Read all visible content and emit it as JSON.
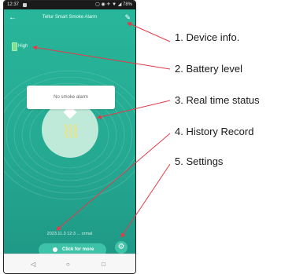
{
  "status_bar": {
    "time": "12:37",
    "indicators": "▢ ◉ ✈ ▼ ◢ 78%"
  },
  "header": {
    "back_icon": "←",
    "title": "Tellur Smart Smoke Alarm",
    "edit_icon": "✎"
  },
  "battery": {
    "label": "High",
    "color": "#7fe08f"
  },
  "status": {
    "text": "No smoke alarm"
  },
  "record": {
    "text": "2023.11.3 12:3 ... ormal"
  },
  "actions": {
    "more_label": "Click for more",
    "settings_icon": "⚙"
  },
  "nav": {
    "back": "◁",
    "home": "○",
    "recents": "□"
  },
  "colors": {
    "accent": "#28b69a",
    "callout": "#e63946"
  },
  "callouts": [
    {
      "label": "1. Device info."
    },
    {
      "label": "2. Battery level"
    },
    {
      "label": "3. Real time status"
    },
    {
      "label": "4. History Record"
    },
    {
      "label": "5. Settings"
    }
  ]
}
